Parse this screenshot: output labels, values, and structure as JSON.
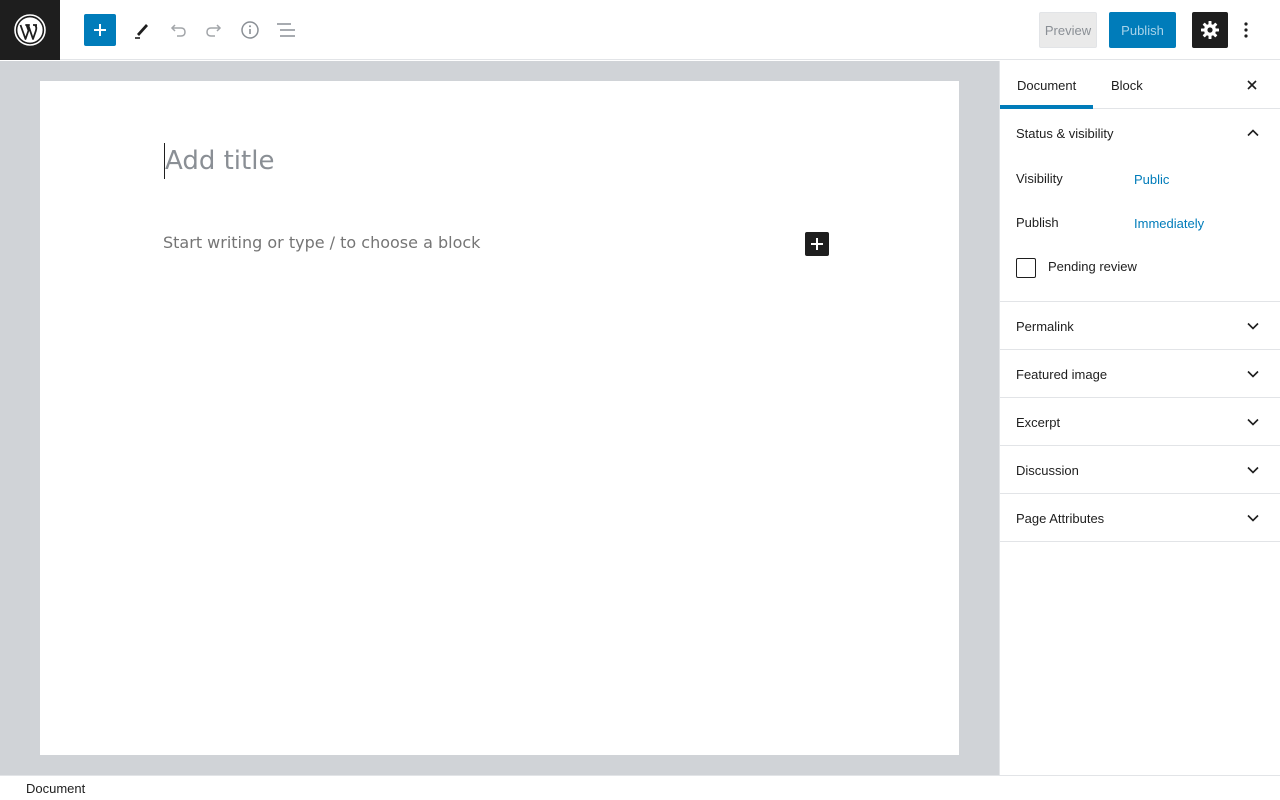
{
  "toolbar": {
    "preview_label": "Preview",
    "publish_label": "Publish"
  },
  "editor": {
    "title_placeholder": "Add title",
    "block_placeholder": "Start writing or type / to choose a block"
  },
  "sidebar": {
    "tabs": [
      {
        "label": "Document"
      },
      {
        "label": "Block"
      }
    ],
    "status_panel": {
      "title": "Status & visibility",
      "visibility_label": "Visibility",
      "visibility_value": "Public",
      "publish_label": "Publish",
      "publish_value": "Immediately",
      "pending_label": "Pending review"
    },
    "panels": [
      {
        "title": "Permalink"
      },
      {
        "title": "Featured image"
      },
      {
        "title": "Excerpt"
      },
      {
        "title": "Discussion"
      },
      {
        "title": "Page Attributes"
      }
    ]
  },
  "footer": {
    "breadcrumb": "Document"
  },
  "colors": {
    "accent": "#007cba",
    "dark": "#1e1e1e",
    "canvas_bg": "#d0d3d7"
  }
}
